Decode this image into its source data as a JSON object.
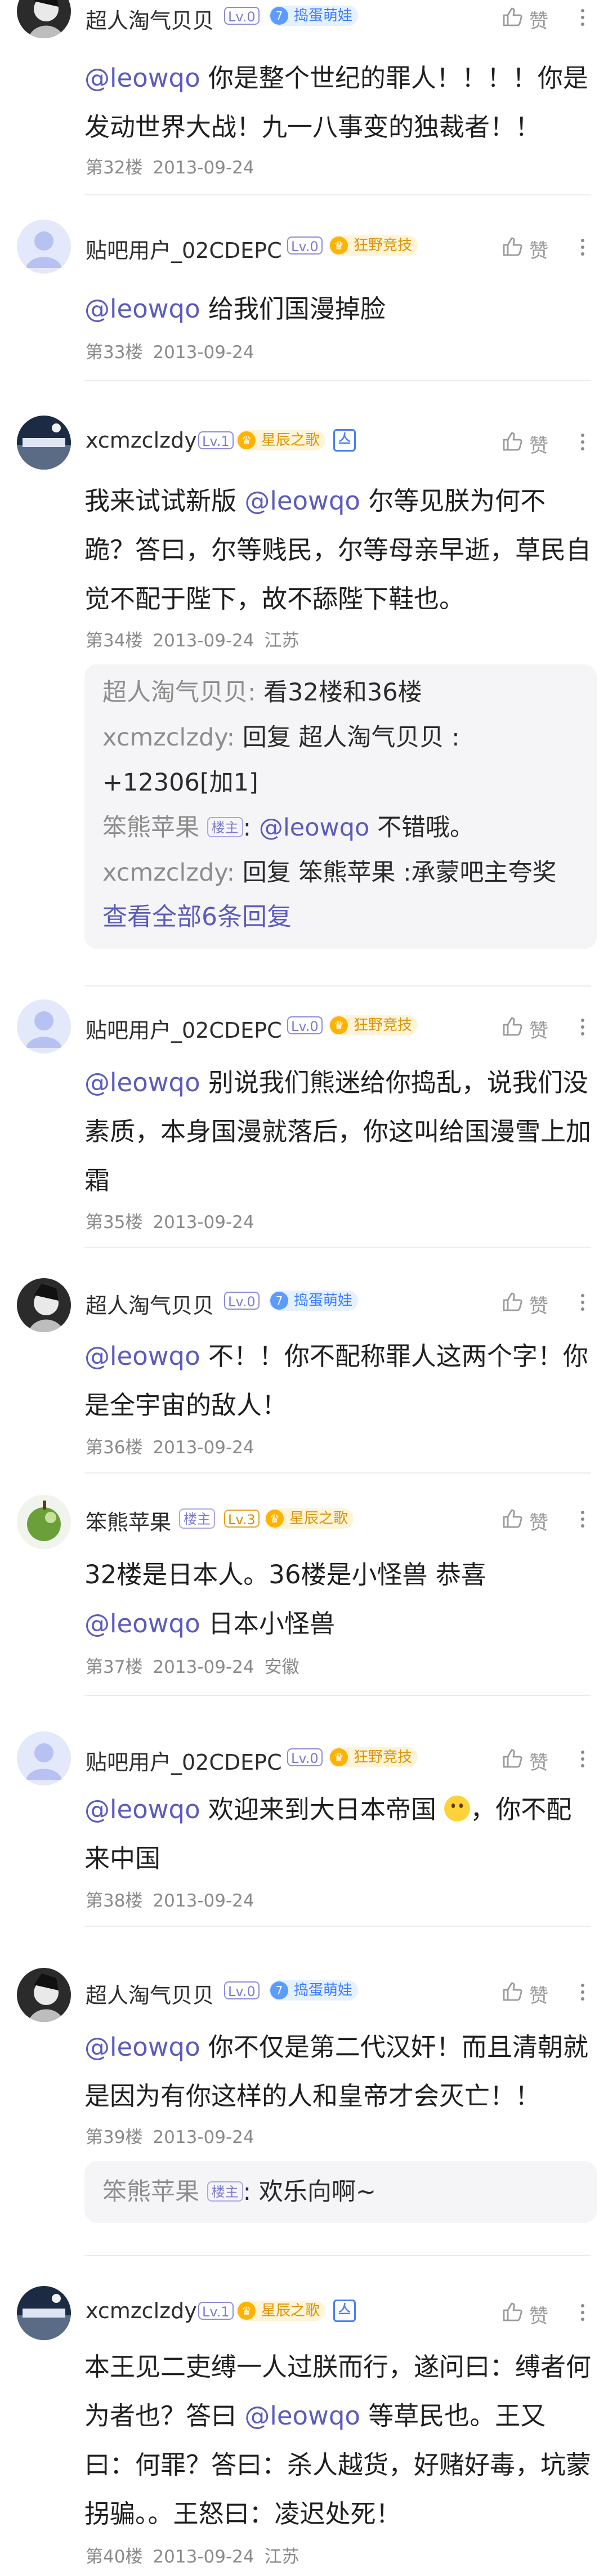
{
  "like_label": "赞",
  "floors": [
    {
      "username": "超人淘气贝贝",
      "level": "Lv.0",
      "fan_badge": "捣蛋萌娃",
      "fan_num": "7",
      "content_html": "<span class=\"at\">@leowqo</span> 你是整个世纪的罪人！！！！你是发动世界大战！九一八事变的独裁者！！",
      "floor": "第32楼",
      "date": "2013-09-24",
      "location": ""
    },
    {
      "username": "贴吧用户_02CDEPC",
      "level": "Lv.0",
      "fan_badge": "狂野竞技",
      "fan_num": "",
      "content_html": "<span class=\"at\">@leowqo</span> 给我们国漫掉脸",
      "floor": "第33楼",
      "date": "2013-09-24",
      "location": ""
    },
    {
      "username": "xcmzclzdy",
      "level": "Lv.1",
      "fan_badge": "星辰之歌",
      "fan_num": "",
      "content_html": "我来试试新版 <span class=\"at\">@leowqo</span> 尔等见朕为何不跪？答曰，尔等贱民，尔等母亲早逝，草民自觉不配于陛下，故不舔陛下鞋也。",
      "floor": "第34楼",
      "date": "2013-09-24",
      "location": "江苏"
    },
    {
      "username": "贴吧用户_02CDEPC",
      "level": "Lv.0",
      "fan_badge": "狂野竞技",
      "fan_num": "",
      "content_html": "<span class=\"at\">@leowqo</span> 别说我们熊迷给你捣乱，说我们没素质，本身国漫就落后，你这叫给国漫雪上加霜",
      "floor": "第35楼",
      "date": "2013-09-24",
      "location": ""
    },
    {
      "username": "超人淘气贝贝",
      "level": "Lv.0",
      "fan_badge": "捣蛋萌娃",
      "fan_num": "7",
      "content_html": "<span class=\"at\">@leowqo</span> 不！！你不配称罪人这两个字！你是全宇宙的敌人！",
      "floor": "第36楼",
      "date": "2013-09-24",
      "location": ""
    },
    {
      "username": "笨熊苹果",
      "level": "Lv.3",
      "louzhu": "楼主",
      "fan_badge": "星辰之歌",
      "fan_num": "",
      "content_html": "32楼是日本人。36楼是小怪兽 恭喜 <span class=\"at\">@leowqo</span> 日本小怪兽",
      "floor": "第37楼",
      "date": "2013-09-24",
      "location": "安徽"
    },
    {
      "username": "贴吧用户_02CDEPC",
      "level": "Lv.0",
      "fan_badge": "狂野竞技",
      "fan_num": "",
      "content_html": "<span class=\"at\">@leowqo</span> 欢迎来到大日本帝国 <span class=\"emoji\" data-name=\"smile-emoji-icon\" data-interactable=\"false\"></span>，你不配来中国",
      "floor": "第38楼",
      "date": "2013-09-24",
      "location": ""
    },
    {
      "username": "超人淘气贝贝",
      "level": "Lv.0",
      "fan_badge": "捣蛋萌娃",
      "fan_num": "7",
      "content_html": "<span class=\"at\">@leowqo</span> 你不仅是第二代汉奸！而且清朝就是因为有你这样的人和皇帝才会灭亡！！",
      "floor": "第39楼",
      "date": "2013-09-24",
      "location": ""
    },
    {
      "username": "xcmzclzdy",
      "level": "Lv.1",
      "fan_badge": "星辰之歌",
      "fan_num": "",
      "content_html": "本王见二吏缚一人过朕而行，遂问曰：缚者何为者也？答曰 <span class=\"at\">@leowqo</span> 等草民也。王又曰：何罪？答曰：杀人越货，好赌好毒，坑蒙拐骗。。王怒曰：凌迟处死！",
      "floor": "第40楼",
      "date": "2013-09-24",
      "location": "江苏"
    }
  ],
  "replies_34": {
    "items": [
      {
        "name": "超人淘气贝贝:",
        "text": " 看32楼和36楼"
      },
      {
        "name": "xcmzclzdy:",
        "text": " 回复 超人淘气贝贝 :"
      },
      {
        "name": "",
        "text": "+12306[加1]"
      },
      {
        "name": "笨熊苹果",
        "louzhu": "楼主",
        "text_html": ": <span class=\"at\">@leowqo</span> 不错哦。"
      },
      {
        "name": "xcmzclzdy:",
        "text": " 回复 笨熊苹果 :承蒙吧主夸奖"
      }
    ],
    "view_all": "查看全部6条回复"
  },
  "replies_39": {
    "items": [
      {
        "name": "笨熊苹果",
        "louzhu": "楼主",
        "text": ": 欢乐向啊~"
      }
    ]
  }
}
